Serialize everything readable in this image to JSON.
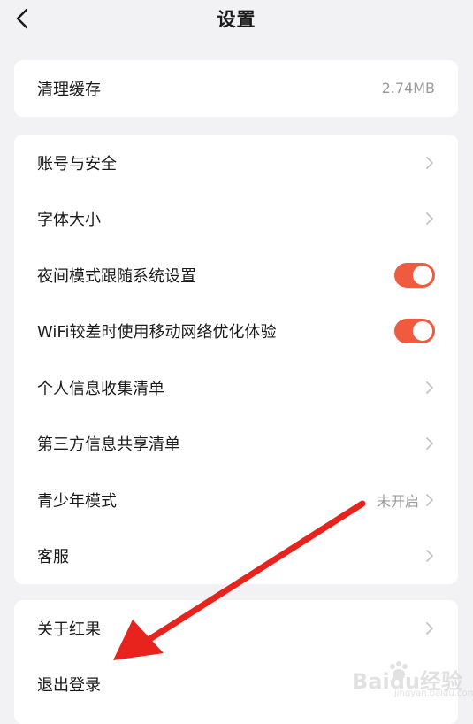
{
  "header": {
    "title": "设置"
  },
  "card1": {
    "items": [
      {
        "label": "清理缓存",
        "value": "2.74MB"
      }
    ]
  },
  "card2": {
    "items": [
      {
        "label": "账号与安全"
      },
      {
        "label": "字体大小"
      },
      {
        "label": "夜间模式跟随系统设置",
        "toggle": true
      },
      {
        "label": "WiFi较差时使用移动网络优化体验",
        "toggle": true
      },
      {
        "label": "个人信息收集清单"
      },
      {
        "label": "第三方信息共享清单"
      },
      {
        "label": "青少年模式",
        "value": "未开启"
      },
      {
        "label": "客服"
      }
    ]
  },
  "card3": {
    "items": [
      {
        "label": "关于红果"
      },
      {
        "label": "退出登录"
      }
    ]
  },
  "colors": {
    "accent": "#f05a3e",
    "annotation": "#e8231e",
    "background": "#f2f2f4"
  },
  "watermark": {
    "text": "Baidu经验",
    "sub": "jingyan.baidu.com"
  }
}
